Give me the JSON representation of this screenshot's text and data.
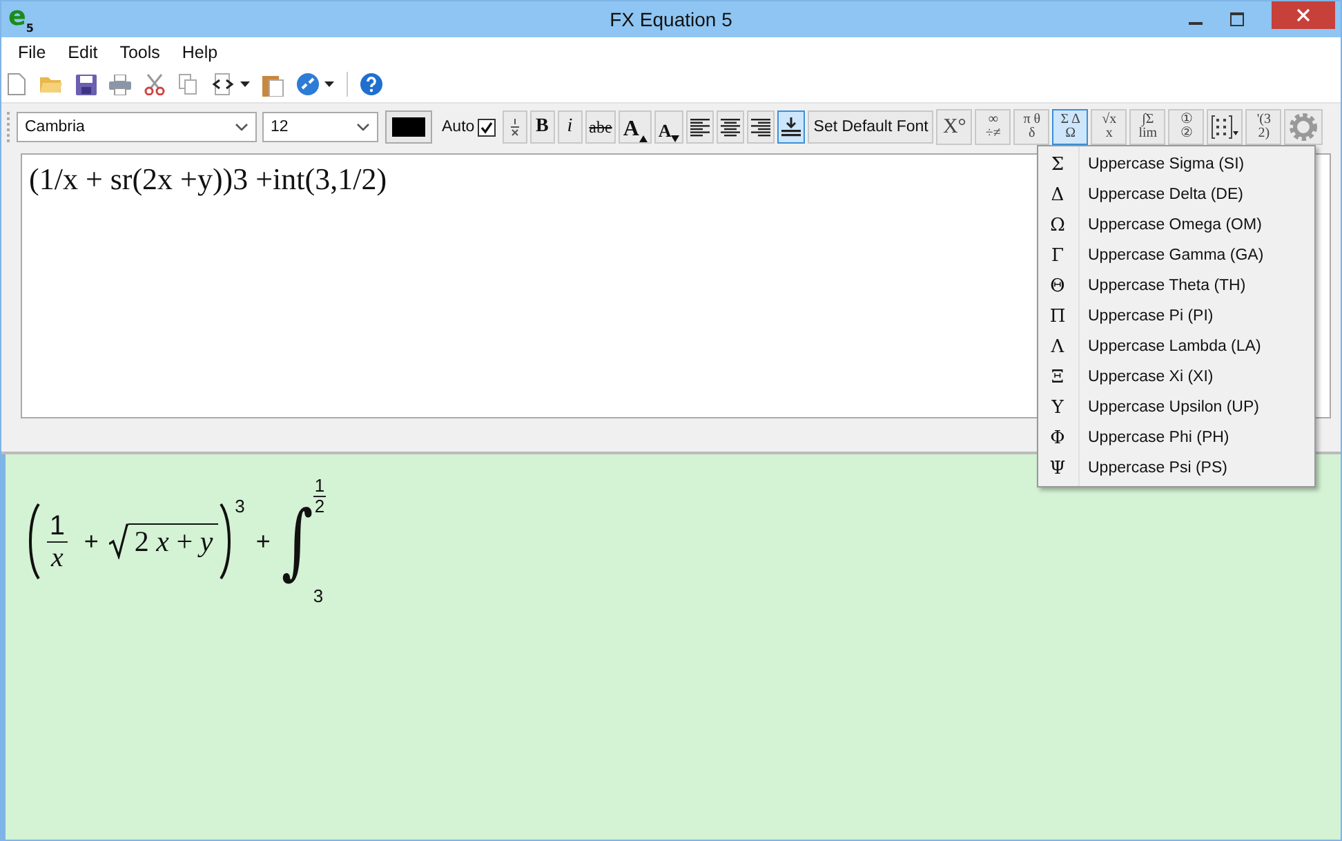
{
  "window": {
    "title": "FX Equation 5",
    "logo_letter": "e",
    "logo_sub": "5"
  },
  "menu": [
    "File",
    "Edit",
    "Tools",
    "Help"
  ],
  "format_toolbar": {
    "font": "Cambria",
    "size": "12",
    "auto_label": "Auto",
    "auto_checked": true,
    "buttons": [
      {
        "kind": "fraction",
        "selected": false
      },
      {
        "kind": "bold",
        "label": "B",
        "selected": false
      },
      {
        "kind": "italic",
        "label": "i",
        "selected": false
      },
      {
        "kind": "strike",
        "label": "abe",
        "selected": false
      },
      {
        "kind": "grow",
        "label": "A",
        "selected": false
      },
      {
        "kind": "shrink",
        "label": "A",
        "selected": false
      },
      {
        "kind": "align-left",
        "selected": false
      },
      {
        "kind": "align-center",
        "selected": false
      },
      {
        "kind": "align-right",
        "selected": false
      },
      {
        "kind": "baseline",
        "selected": true
      },
      {
        "kind": "wide",
        "label": "Set Default Font",
        "selected": false
      },
      {
        "kind": "symbols",
        "symbols": [
          "X°"
        ],
        "selected": false
      },
      {
        "kind": "symbols",
        "symbols": [
          "∞",
          "÷≠"
        ],
        "selected": false
      },
      {
        "kind": "symbols",
        "symbols": [
          "π θ",
          "δ"
        ],
        "selected": false
      },
      {
        "kind": "symbols",
        "symbols": [
          "Σ Δ",
          "Ω"
        ],
        "selected": true
      },
      {
        "kind": "symbols",
        "symbols": [
          "√x",
          "x"
        ],
        "selected": false
      },
      {
        "kind": "symbols",
        "symbols": [
          "∫Σ",
          "lim"
        ],
        "selected": false
      },
      {
        "kind": "symbols",
        "symbols": [
          "①",
          "②"
        ],
        "selected": false
      },
      {
        "kind": "matrix",
        "selected": false
      },
      {
        "kind": "symbols",
        "symbols": [
          "'(3",
          "2)"
        ],
        "selected": false
      },
      {
        "kind": "gear",
        "selected": false
      }
    ]
  },
  "editor": {
    "value": "(1/x + sr(2x +y))3 +int(3,1/2)"
  },
  "symbol_menu": [
    {
      "symbol": "Σ",
      "label": "Uppercase Sigma (SI)"
    },
    {
      "symbol": "Δ",
      "label": "Uppercase Delta (DE)"
    },
    {
      "symbol": "Ω",
      "label": "Uppercase Omega (OM)"
    },
    {
      "symbol": "Γ",
      "label": "Uppercase Gamma (GA)"
    },
    {
      "symbol": "Θ",
      "label": "Uppercase Theta (TH)"
    },
    {
      "symbol": "Π",
      "label": "Uppercase Pi (PI)"
    },
    {
      "symbol": "Λ",
      "label": "Uppercase Lambda (LA)"
    },
    {
      "symbol": "Ξ",
      "label": "Uppercase Xi (XI)"
    },
    {
      "symbol": "Υ",
      "label": "Uppercase Upsilon (UP)"
    },
    {
      "symbol": "Φ",
      "label": "Uppercase Phi (PH)"
    },
    {
      "symbol": "Ψ",
      "label": "Uppercase Psi (PS)"
    }
  ],
  "preview": {
    "numerator": "1",
    "denominator": "x",
    "plus_1": "+",
    "radicand": "2 *x* + *y*",
    "exponent": "3",
    "plus_2": "+",
    "integral": "∫",
    "upper_num": "1",
    "upper_den": "2",
    "lower_limit": "3"
  }
}
